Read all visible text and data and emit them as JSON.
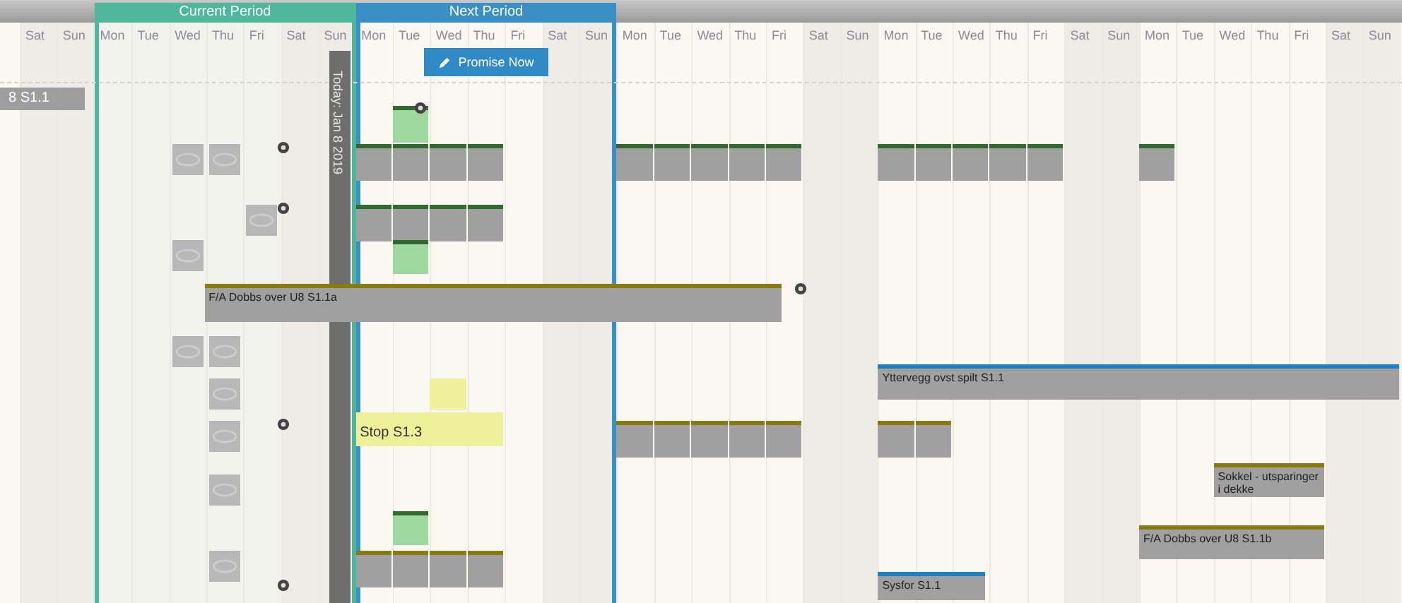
{
  "periods": [
    {
      "label": "Current Period",
      "color": "#4fb79b"
    },
    {
      "label": "Next Period",
      "color": "#3a8fc4"
    }
  ],
  "days": [
    "Sat",
    "Sun",
    "Mon",
    "Tue",
    "Wed",
    "Thu",
    "Fri",
    "Sat",
    "Sun",
    "Mon",
    "Tue",
    "Wed",
    "Thu",
    "Fri",
    "Sat",
    "Sun",
    "Mon",
    "Tue",
    "Wed",
    "Thu",
    "Fri",
    "Sat",
    "Sun",
    "Mon",
    "Tue",
    "Wed",
    "Thu",
    "Fri",
    "Sat",
    "Sun",
    "Mon",
    "Tue",
    "Wed",
    "Thu",
    "Fri",
    "Sat",
    "Sun"
  ],
  "promise_button": "Promise Now",
  "today_label": "Today: Jan 8 2019",
  "row_label": "8 S1.1",
  "tasks": [
    {
      "color": "#2f6b2f"
    },
    {
      "color": "#2f6b2f"
    },
    {
      "color": "#2f6b2f"
    },
    {
      "color": "#2f6b2f"
    },
    {
      "color": "#2f6b2f"
    },
    {
      "color": "#2f6b2f"
    },
    {
      "color": "#2f6b2f"
    },
    {
      "color": "#2f6b2f"
    },
    {
      "color": "#2f6b2f"
    },
    {
      "color": "#2f6b2f"
    },
    {
      "color": "#2f6b2f"
    },
    {
      "color": "#2f6b2f"
    },
    {
      "color": "#2f6b2f"
    },
    {
      "color": "#2f6b2f"
    },
    {
      "color": "#2f6b2f"
    },
    {
      "color": "#2f6b2f"
    },
    {
      "color": "#2f6b2f"
    },
    {
      "color": "#2f6b2f"
    },
    {
      "color": "#2f6b2f"
    },
    {
      "color": "#8a7a12",
      "text": "F/A Dobbs over U8 S1.1a"
    },
    {
      "color": "#1e7fc4",
      "text": "Yttervegg ovst spilt S1.1"
    },
    {
      "color": "#8a7a12"
    },
    {
      "color": "#8a7a12"
    },
    {
      "color": "#8a7a12"
    },
    {
      "color": "#8a7a12"
    },
    {
      "color": "#8a7a12"
    },
    {
      "color": "#8a7a12"
    },
    {
      "color": "#8a7a12"
    },
    {
      "color": "#8a7a12",
      "text": "Sokkel - utsparinger i dekke"
    },
    {
      "color": "#8a7a12",
      "text": "F/A Dobbs over U8 S1.1b"
    },
    {
      "color": "#1e7fc4",
      "text": "Sysfor S1.1"
    },
    {
      "color": "#8a7a12"
    },
    {
      "color": "#8a7a12"
    },
    {
      "color": "#8a7a12"
    },
    {
      "color": "#8a7a12"
    }
  ],
  "notes": [
    {
      "kind": "green"
    },
    {
      "kind": "green"
    },
    {
      "kind": "green"
    },
    {
      "kind": "yellow",
      "text": "Stop S1.3"
    },
    {
      "kind": "yellow"
    }
  ]
}
